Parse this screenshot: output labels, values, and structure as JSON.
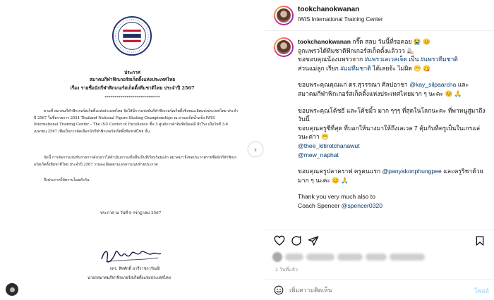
{
  "post": {
    "username": "tookchanokwanan",
    "location": "IWIS International Training Center",
    "date": "1 วันที่แล้ว",
    "comment_placeholder": "เพิ่มความคิดเห็น",
    "post_label": "โพสต์"
  },
  "caption": {
    "p1": [
      "กรี๊ด สลบ วันนี้ที่รอคอย 😭 😊",
      "ลูกแพรวได้ทีมชาติฟิกเกอร์สเก็ตตั้งแล้ววว ⛸️",
      "ขอขอบคุณน้องแพรวจาก",
      "#แพรวเลเวลเจ็ด",
      " เป็น ",
      "#แพรวทีมชาติ",
      "ส่วนแม่ลูก เรียก ",
      "#แม่ทีมชาติ",
      " ได้เลยจ้ะ ไม่ผิด 😁 😋"
    ],
    "p2": [
      "ขอบพระคุณคุณแก่ ดร.สุวรรณา ศิลปอาชา ",
      "@kay_silpaarcha",
      " และสมาคมกีฬาฟิกเกอร์สเก็ตติ้งแห่งประเทศไทยมาก ๆ นะคะ 😊 🙏"
    ],
    "p3": [
      "ขอบพระคุณโค้ชธี และโค้ชมิ้ว มาก ๆๆๆ ที่สุดในโลกนะคะ ที่พาหนูสู่มาถึงวันนี้",
      "ขอบคุณครูซีที่สุด ที่บอกให้นางมาให้ถึงเลเวล 7 คุ้มกับที่ครูเป็นในเกรแล่วนะค่าา 😁",
      "@thee_kitirotchanawut",
      "@mew_naphat"
    ],
    "p4": [
      "ขอบคุณครูปลาคราฟ ครูคนแรก ",
      "@panyakonphungpee",
      " และครูริชาด้วยมาก ๆ นะคะ 😊 🙏"
    ],
    "p5": [
      "Thank you very much also to",
      "Coach Spencer ",
      "@spencer0320"
    ]
  },
  "document": {
    "title_line1": "ประกาศ",
    "title_line2": "สมาคมกีฬาฟิกเกอร์สเก็ตติ้งแห่งประเทศไทย",
    "title_line3": "เรื่อง รายชื่อนักกีฬาฟิกเกอร์สเก็ตติ้งทีมชาติไทย ประจำปี 2567",
    "stars": "****************************",
    "para1": "ตามที่ สมาคมกีฬาฟิกเกอร์สเก็ตติ้งแห่งประเทศไทย จัดให้มีการแข่งขันกีฬาฟิกเกอร์สเก็ตติ้งชิงชนะเลิศแห่งประเทศไทย ประจำปี 2567 ในชื่อรายการ 2024 Thailand National Figure Skating Championships ณ ลานสเก็ตน้ำแข็ง IWIS International Training Center – The ISU Center of Excellence ชั้น 5 ศูนย์การค้าอินฟิเนียเดลี่ สำโรง เมื่อวันที่ 3-6 เมษายน 2567 เพื่อเป็นการคัดเลือกนักกีฬาฟิกเกอร์สเก็ตติ้งทีมชาติไทย นั้น",
    "para2": "บัดนี้ การจัดการแข่งขันรายการดังกล่าวได้ดำเนินการเสร็จสิ้นเป็นที่เรียบร้อยแล้ว สมาคมฯ จึงขอประกาศรายชื่อนักกีฬาฟิกเกอร์สเก็ตติ้งทีมชาติไทย ประจำปี 2567 รายละเอียดตามเอกสารแนบท้ายประกาศ",
    "para3": "จึงประกาศให้ทราบโดยทั่วกัน",
    "date_line": "ประกาศ ณ วันที่  9 กรกฎาคม 2567",
    "signer_name": "(ดร. สิทศักดิ์ อารีราชการัณย์)",
    "signer_title": "นายกสมาคมกีฬาฟิกเกอร์สเก็ตติ้งแห่งประเทศไทย"
  },
  "colors": {
    "link": "#00376b",
    "post_disabled": "#b2dffc",
    "muted": "#8e8e8e"
  }
}
